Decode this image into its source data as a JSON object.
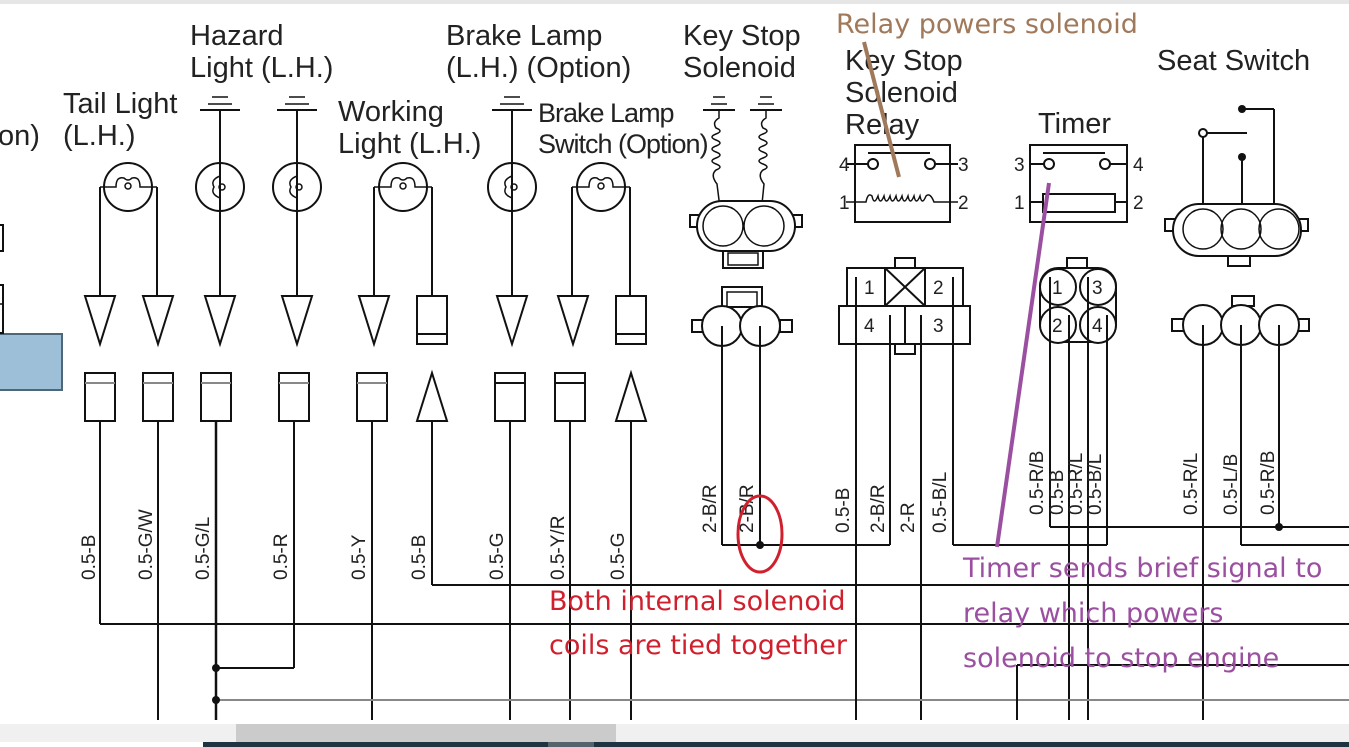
{
  "components": {
    "partial_left": "on)",
    "tail_light": [
      "Tail Light",
      "(L.H.)"
    ],
    "hazard_light": [
      "Hazard",
      "Light (L.H.)"
    ],
    "working_light": [
      "Working",
      "Light (L.H.)"
    ],
    "brake_lamp": [
      "Brake Lamp",
      "(L.H.) (Option)"
    ],
    "brake_lamp_switch": [
      "Brake Lamp",
      "Switch (Option)"
    ],
    "key_stop_solenoid": [
      "Key Stop",
      "Solenoid"
    ],
    "key_stop_solenoid_relay": [
      "Key Stop",
      "Solenoid",
      "Relay"
    ],
    "timer": "Timer",
    "seat_switch": "Seat Switch"
  },
  "relay_pins": {
    "top_left": "4",
    "top_right": "3",
    "bottom_left": "1",
    "bottom_right": "2"
  },
  "timer_pins": {
    "top_left": "3",
    "top_right": "4",
    "bottom_left": "1",
    "bottom_right": "2"
  },
  "relay_connector_pins": [
    "1",
    "2",
    "4",
    "3"
  ],
  "timer_connector_pins": [
    "1",
    "3",
    "2",
    "4"
  ],
  "wire_labels": [
    "0.5-B",
    "0.5-G/W",
    "0.5-G/L",
    "0.5-R",
    "0.5-Y",
    "0.5-B",
    "0.5-G",
    "0.5-Y/R",
    "0.5-G",
    "2-B/R",
    "2-B/R",
    "0.5-B",
    "2-B/R",
    "2-R",
    "0.5-B/L",
    "0.5-R/B",
    "0.5-B",
    "0.5-R/L",
    "0.5-B/L",
    "0.5-R/L",
    "0.5-L/B",
    "0.5-R/B"
  ],
  "annotations": {
    "relay": {
      "text": "Relay powers solenoid",
      "color": "#a0785a"
    },
    "solenoid": {
      "lines": [
        "Both internal solenoid",
        "coils are tied together"
      ],
      "color": "#d0202e"
    },
    "timer": {
      "lines": [
        "Timer sends brief signal to",
        "relay which powers",
        "solenoid to stop engine"
      ],
      "color": "#9b4fa0"
    }
  },
  "colors": {
    "highlight_box": "#9dbfd8"
  }
}
